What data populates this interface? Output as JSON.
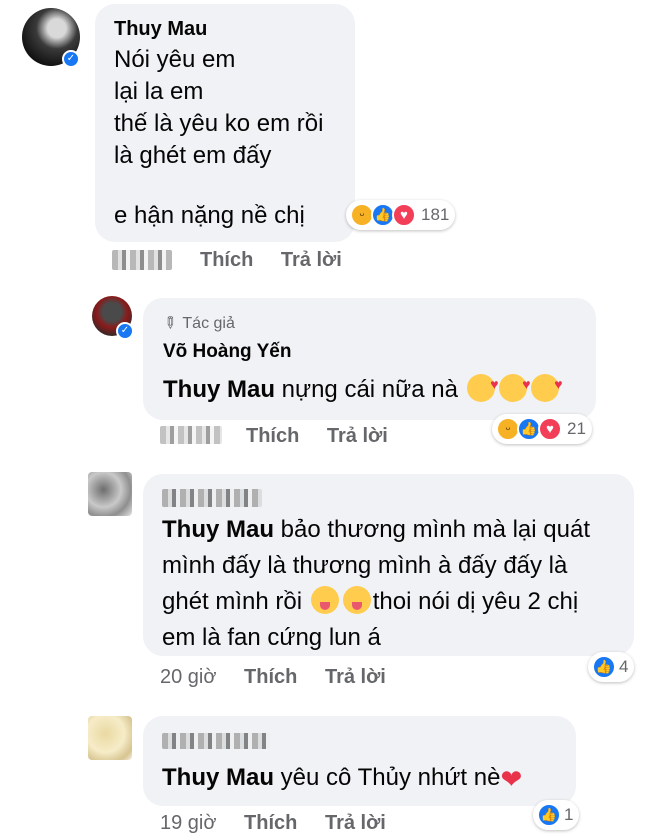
{
  "comments": [
    {
      "name": "Thuy Mau",
      "lines": [
        "Nói yêu em",
        "lại la em",
        "thế là yêu ko em rồi",
        "là ghét em đấy",
        "",
        "e hận nặng nề chị"
      ],
      "reaction_count": "181",
      "like_label": "Thích",
      "reply_label": "Trả lời"
    },
    {
      "author_badge": "Tác giả",
      "name": "Võ Hoàng Yến",
      "mention": "Thuy Mau",
      "text": "nựng cái nữa nà",
      "reaction_count": "21",
      "like_label": "Thích",
      "reply_label": "Trả lời"
    },
    {
      "mention": "Thuy Mau",
      "line1": "bảo thương mình mà lại quát",
      "line2": "mình đấy là thương mình à đấy đấy là",
      "line3a": "ghét mình rồi",
      "line3b": "thoi nói dị yêu 2 chị",
      "line4": "em là fan cứng lun á",
      "time": "20 giờ",
      "reaction_count": "4",
      "like_label": "Thích",
      "reply_label": "Trả lời"
    },
    {
      "mention": "Thuy Mau",
      "text": "yêu cô Thủy nhứt nè",
      "time": "19 giờ",
      "reaction_count": "1",
      "like_label": "Thích",
      "reply_label": "Trả lời"
    }
  ],
  "colors": {
    "bubble": "#f0f2f5",
    "accent": "#1877f2",
    "meta": "#65676b",
    "love": "#f33e58"
  },
  "icons": [
    "verified-badge-icon",
    "pencil-icon",
    "haha-reaction-icon",
    "like-reaction-icon",
    "love-reaction-icon",
    "heart-emoji-icon"
  ]
}
